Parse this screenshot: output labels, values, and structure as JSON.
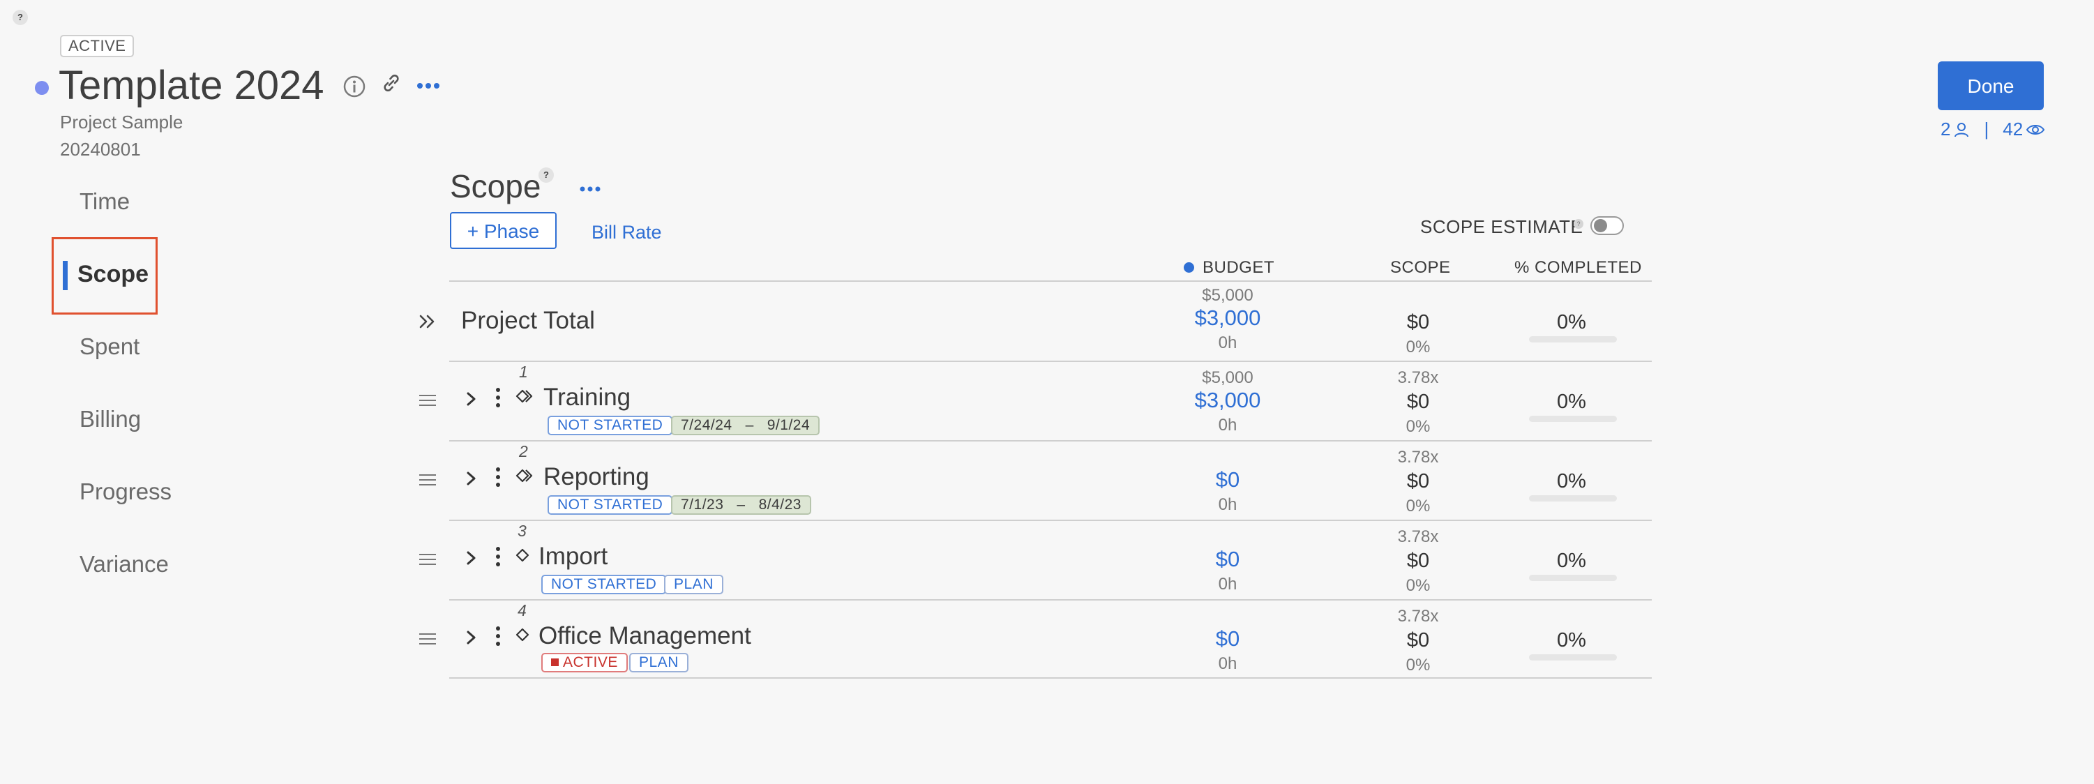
{
  "header": {
    "help_glyph": "?",
    "status": "ACTIVE",
    "title": "Template 2024",
    "subtitle_line1": "Project Sample",
    "subtitle_line2": "20240801",
    "done_label": "Done",
    "members_count": "2",
    "separator": "|",
    "viewers_count": "42",
    "accent_color": "#2f6fd4"
  },
  "nav": {
    "items": [
      {
        "label": "Time"
      },
      {
        "label": "Scope",
        "selected": true
      },
      {
        "label": "Spent"
      },
      {
        "label": "Billing"
      },
      {
        "label": "Progress"
      },
      {
        "label": "Variance"
      }
    ]
  },
  "scope": {
    "title": "Scope",
    "help_glyph": "?",
    "add_phase_label": "+ Phase",
    "bill_rate_label": "Bill Rate",
    "scope_estimate_label": "SCOPE ESTIMATE",
    "scope_estimate_on": false,
    "columns": {
      "budget": "BUDGET",
      "scope": "SCOPE",
      "completed": "% COMPLETED"
    },
    "total": {
      "label": "Project Total",
      "budget_top": "$5,000",
      "budget_main": "$3,000",
      "budget_hours": "0h",
      "scope_main": "$0",
      "scope_pct": "0%",
      "completed": "0%",
      "completed_fraction": 0
    },
    "phases": [
      {
        "number": "1",
        "name": "Training",
        "tags": [
          {
            "text": "NOT STARTED",
            "kind": "blue"
          },
          {
            "text": "7/24/24   –   9/1/24",
            "kind": "date"
          }
        ],
        "budget_top": "$5,000",
        "budget_main": "$3,000",
        "budget_hours": "0h",
        "scope_multiplier": "3.78x",
        "scope_main": "$0",
        "scope_pct": "0%",
        "completed": "0%",
        "completed_fraction": 0
      },
      {
        "number": "2",
        "name": "Reporting",
        "tags": [
          {
            "text": "NOT STARTED",
            "kind": "blue"
          },
          {
            "text": "7/1/23   –   8/4/23",
            "kind": "date"
          }
        ],
        "budget_top": "",
        "budget_main": "$0",
        "budget_hours": "0h",
        "scope_multiplier": "3.78x",
        "scope_main": "$0",
        "scope_pct": "0%",
        "completed": "0%",
        "completed_fraction": 0
      },
      {
        "number": "3",
        "name": "Import",
        "tags": [
          {
            "text": "NOT STARTED",
            "kind": "blue"
          },
          {
            "text": "PLAN",
            "kind": "plan"
          }
        ],
        "budget_top": "",
        "budget_main": "$0",
        "budget_hours": "0h",
        "scope_multiplier": "3.78x",
        "scope_main": "$0",
        "scope_pct": "0%",
        "completed": "0%",
        "completed_fraction": 0
      },
      {
        "number": "4",
        "name": "Office Management",
        "tags": [
          {
            "text": "ACTIVE",
            "kind": "red"
          },
          {
            "text": "PLAN",
            "kind": "plan"
          }
        ],
        "budget_top": "",
        "budget_main": "$0",
        "budget_hours": "0h",
        "scope_multiplier": "3.78x",
        "scope_main": "$0",
        "scope_pct": "0%",
        "completed": "0%",
        "completed_fraction": 0
      }
    ]
  }
}
